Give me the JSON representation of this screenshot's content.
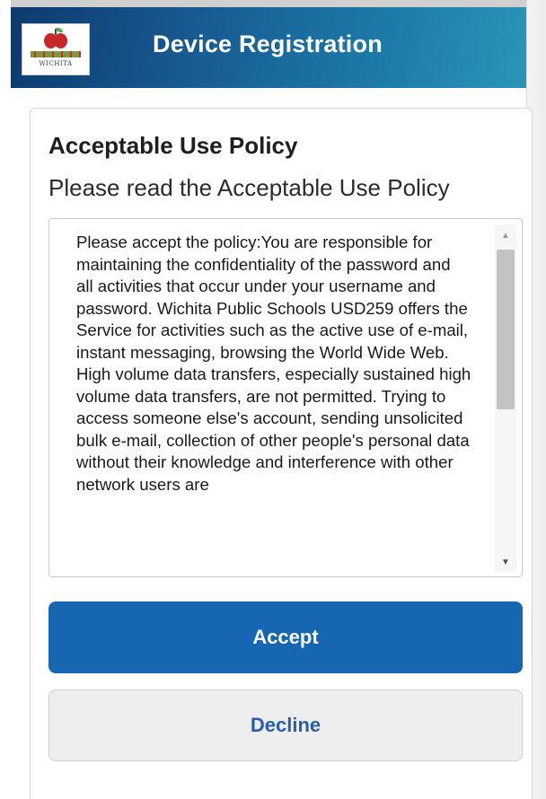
{
  "header": {
    "title": "Device Registration",
    "logo_text": "WICHITA",
    "logo_icon": "apple-logo-icon"
  },
  "policy": {
    "title": "Acceptable Use Policy",
    "subtitle": "Please read the Acceptable Use Policy",
    "text": "Please accept the policy:You are responsible for maintaining the confidentiality of the password and all activities that occur under your username and password. Wichita Public Schools USD259 offers the Service for activities such as the active use of e-mail, instant messaging, browsing the World Wide Web. High volume data transfers, especially sustained high volume data transfers, are not permitted. Trying to access someone else's account, sending unsolicited bulk e-mail, collection of other people's personal data without their knowledge and interference with other network users are",
    "scroll_up_icon": "scroll-up-arrow-icon",
    "scroll_down_icon": "scroll-down-arrow-icon"
  },
  "actions": {
    "accept_label": "Accept",
    "decline_label": "Decline"
  },
  "colors": {
    "header_dark": "#0d3a6e",
    "header_light": "#2a95b9",
    "accept_bg": "#1766b2",
    "decline_text": "#2a5fa8"
  }
}
